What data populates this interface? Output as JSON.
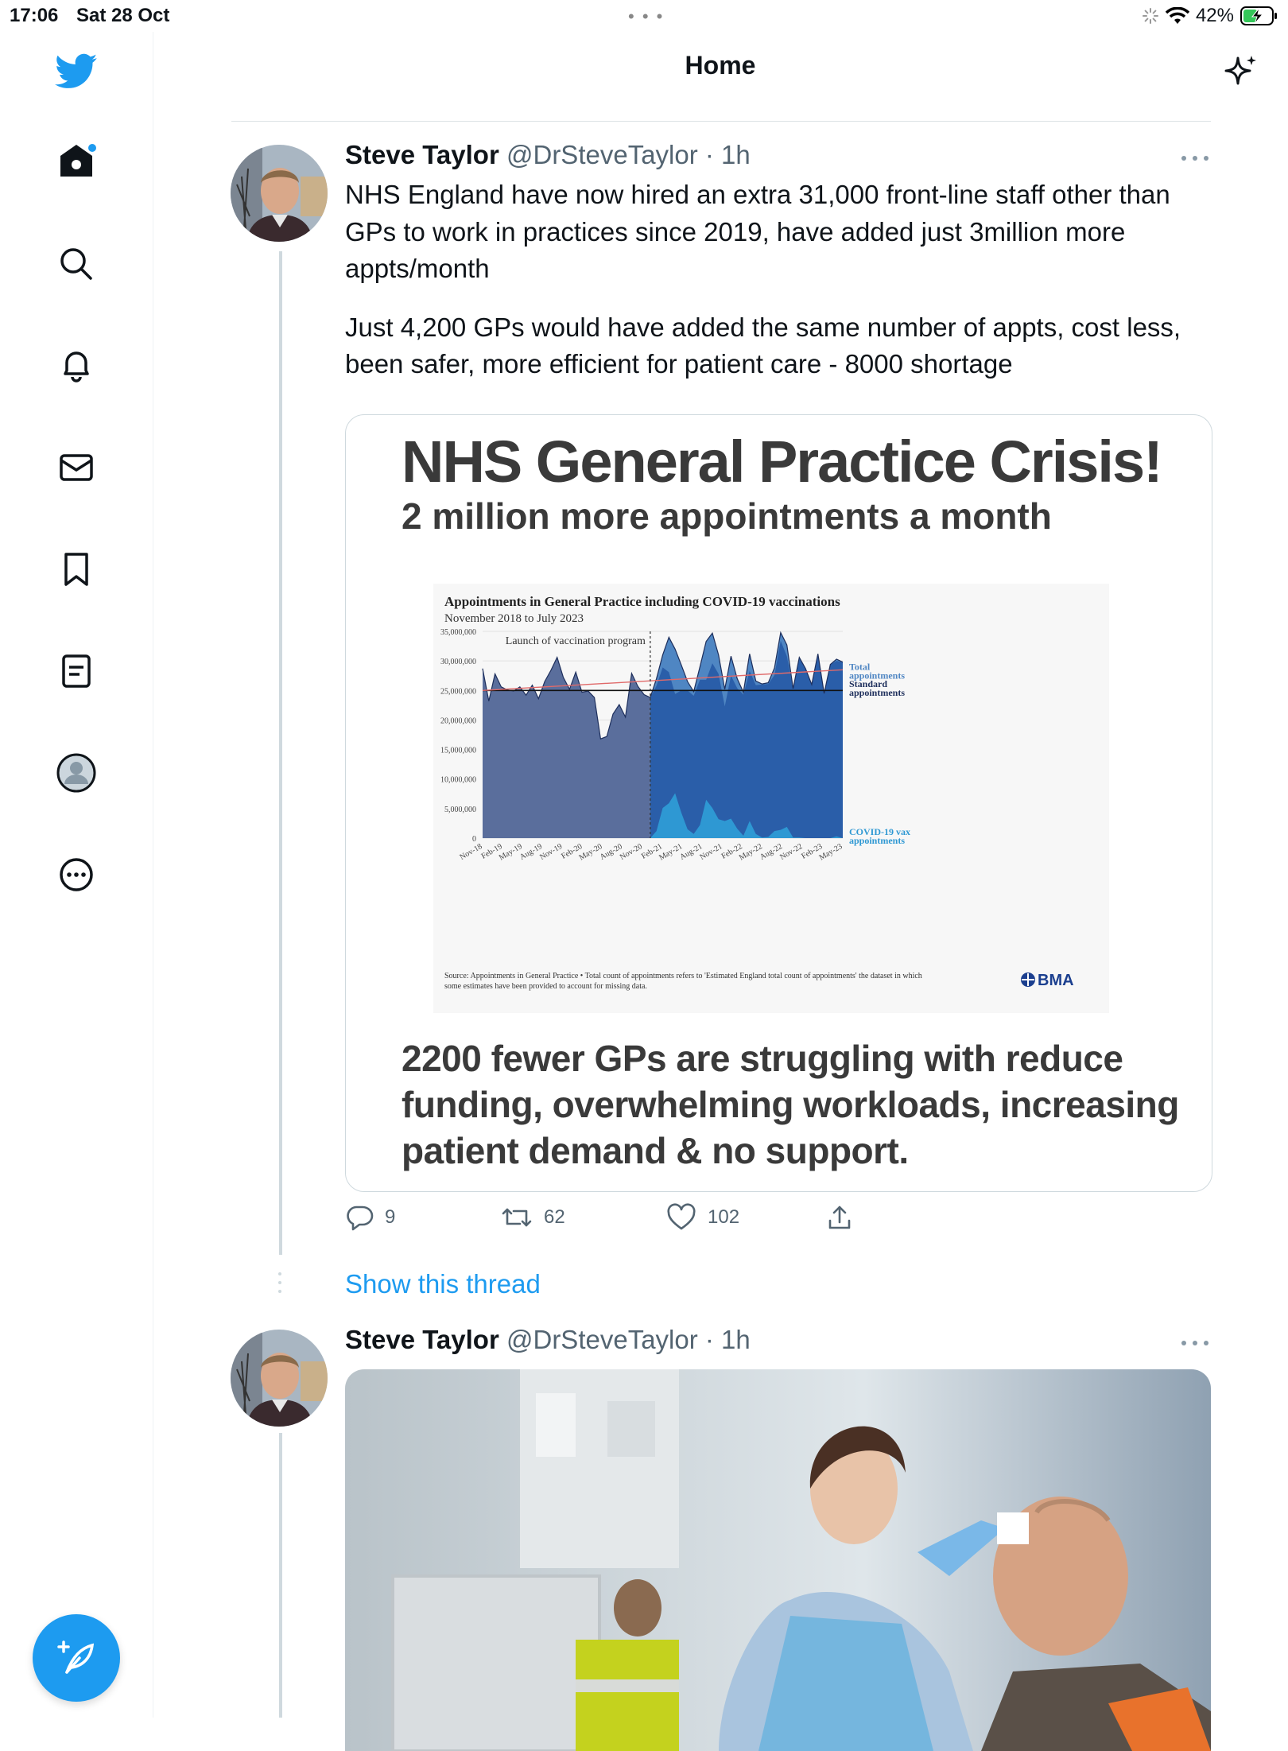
{
  "status_bar": {
    "time": "17:06",
    "date": "Sat 28 Oct",
    "battery": "42%"
  },
  "header": {
    "title": "Home"
  },
  "nav": [
    "twitter-logo",
    "home",
    "search",
    "notifications",
    "messages",
    "bookmarks",
    "lists",
    "profile",
    "more"
  ],
  "tweets": [
    {
      "name": "Steve Taylor",
      "handle": "@DrSteveTaylor",
      "time": "· 1h",
      "text1": "NHS England have now hired an extra 31,000 front-line staff other than GPs to work in practices since 2019, have added just 3million more appts/month",
      "text2": "Just 4,200 GPs would have added the same number of appts, cost less, been safer, more efficient for patient care - 8000 shortage",
      "media": {
        "title": "NHS General Practice Crisis!",
        "subtitle": "2 million more appointments a month",
        "bottom_text": "2200 fewer GPs are struggling with reduce funding, overwhelming workloads, increasing patient demand & no support."
      },
      "actions": {
        "replies": "9",
        "retweets": "62",
        "likes": "102"
      }
    },
    {
      "name": "Steve Taylor",
      "handle": "@DrSteveTaylor",
      "time": "· 1h"
    }
  ],
  "show_thread": "Show this thread",
  "chart_data": {
    "type": "area",
    "title": "Appointments in General Practice including COVID-19 vaccinations",
    "subtitle": "November 2018 to July 2023",
    "annotation": "Launch of vaccination program",
    "ylim": [
      0,
      35000000
    ],
    "y_ticks": [
      "35,000,000",
      "30,000,000",
      "25,000,000",
      "20,000,000",
      "15,000,000",
      "10,000,000",
      "5,000,000",
      "0"
    ],
    "x_ticks": [
      "Nov-18",
      "Feb-19",
      "May-19",
      "Aug-19",
      "Nov-19",
      "Feb-20",
      "May-20",
      "Aug-20",
      "Nov-20",
      "Feb-21",
      "May-21",
      "Aug-21",
      "Nov-21",
      "Feb-22",
      "May-22",
      "Aug-22",
      "Nov-22",
      "Feb-23",
      "May-23"
    ],
    "series": [
      {
        "name": "Total appointments",
        "values": [
          28.7,
          23.2,
          27.8,
          25.6,
          25.1,
          24.9,
          25.6,
          24.2,
          25.9,
          23.6,
          26.5,
          28.4,
          30.6,
          27.2,
          25.2,
          28.1,
          24.7,
          24.9,
          23.8,
          16.8,
          17.2,
          21.0,
          22.6,
          20.5,
          27.9,
          25.7,
          24.3,
          23.8,
          27.0,
          31.0,
          34.0,
          32.0,
          29.3,
          26.5,
          24.8,
          29.0,
          33.3,
          34.7,
          31.0,
          25.2,
          30.8,
          27.0,
          24.7,
          31.2,
          26.6,
          26.1,
          26.3,
          28.8,
          34.8,
          32.7,
          25.3,
          30.6,
          28.7,
          26.0,
          31.2,
          24.5,
          29.4,
          30.3,
          29.8
        ]
      },
      {
        "name": "Standard appointments",
        "values": [
          28.7,
          23.2,
          27.8,
          25.6,
          25.1,
          24.9,
          25.6,
          24.2,
          25.9,
          23.6,
          26.5,
          28.4,
          30.6,
          27.2,
          25.2,
          28.1,
          24.7,
          24.9,
          23.8,
          16.8,
          17.2,
          21.0,
          22.6,
          20.5,
          27.9,
          25.7,
          24.3,
          23.8,
          25.8,
          28.9,
          28.1,
          24.4,
          25.0,
          25.0,
          24.1,
          26.8,
          26.8,
          29.6,
          27.8,
          22.3,
          27.5,
          25.4,
          24.3,
          28.3,
          25.9,
          26.0,
          26.1,
          27.6,
          33.4,
          30.8,
          25.2,
          30.5,
          28.7,
          26.0,
          31.2,
          24.5,
          29.4,
          30.0,
          29.8
        ]
      },
      {
        "name": "COVID-19 vax appointments",
        "values": [
          0,
          0,
          0,
          0,
          0,
          0,
          0,
          0,
          0,
          0,
          0,
          0,
          0,
          0,
          0,
          0,
          0,
          0,
          0,
          0,
          0,
          0,
          0,
          0,
          0,
          0,
          0,
          0,
          1.2,
          5.1,
          5.9,
          7.6,
          4.3,
          1.5,
          0.7,
          2.2,
          6.5,
          5.1,
          3.2,
          2.9,
          3.3,
          1.6,
          0.4,
          2.9,
          0.7,
          0.1,
          0.2,
          1.2,
          1.4,
          1.9,
          0.1,
          0.1,
          0,
          0,
          0,
          0,
          0,
          0.3,
          0
        ]
      },
      {
        "name": "Standard appointments baseline",
        "values": [
          25.0
        ]
      },
      {
        "name": "Trend",
        "values": [
          25.0,
          28.5
        ]
      }
    ],
    "source_text": "Source: Appointments in General Practice • Total count of appointments refers to 'Estimated England total count of appointments' the dataset in which some estimates have been provided to account for missing data.",
    "brand": "BMA",
    "colors": {
      "pre": "#5a6e9c",
      "standard": "#2a5ea9",
      "total": "#4f86c3",
      "vax": "#2e98d3",
      "trend": "#e06a6a",
      "baseline": "#111111"
    }
  }
}
